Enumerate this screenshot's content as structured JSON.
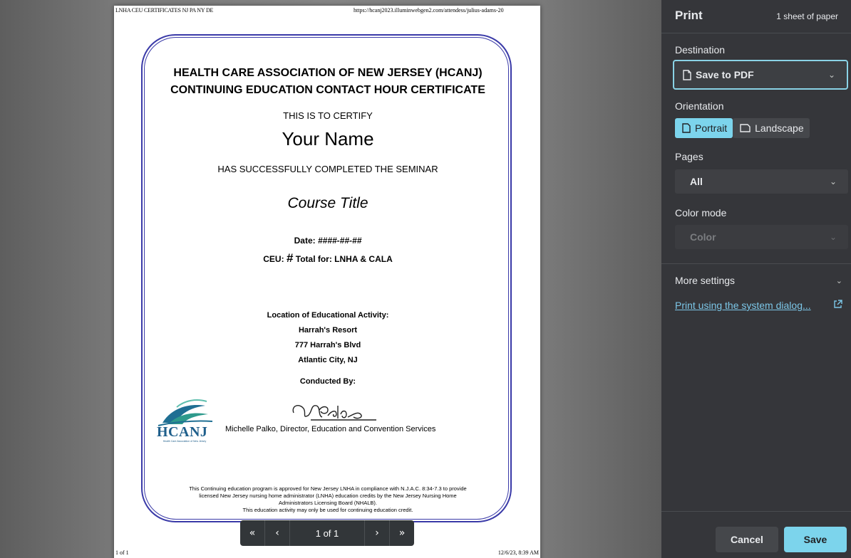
{
  "document": {
    "header_left": "LNHA CEU CERTIFICATES NJ PA NY DE",
    "header_right": "https://hcanj2023.illuminwebgen2.com/attendess/julius-adams-20",
    "footer_left": "1 of 1",
    "footer_right": "12/6/23, 8:39 AM",
    "title_line1": "HEALTH CARE ASSOCIATION OF NEW JERSEY (HCANJ)",
    "title_line2": "CONTINUING EDUCATION CONTACT HOUR CERTIFICATE",
    "certify": "THIS IS TO CERTIFY",
    "name": "Your Name",
    "completed": "HAS SUCCESSFULLY COMPLETED THE SEMINAR",
    "course": "Course Title",
    "date_label": "Date:",
    "date_value": "####-##-##",
    "ceu_label": "CEU:",
    "ceu_value": "#",
    "total_for": "Total for: LNHA & CALA",
    "location_label": "Location of Educational Activity:",
    "location_lines": [
      "Harrah's Resort",
      "777 Harrah's Blvd",
      "Atlantic City, NJ"
    ],
    "conducted_by": "Conducted By:",
    "signature_text": "Palko",
    "signer": "Michelle Palko, Director, Education and Convention Services",
    "logo_text": "HCANJ",
    "logo_subtext": "Health Care Association of New Jersey",
    "fine_print": [
      "This Continuing education program is approved for New Jersey LNHA in compliance with N.J.A.C. 8:34-7.3 to provide",
      "licensed New Jersey nursing home administrator (LNHA) education credits by the New Jersey Nursing Home",
      "Administrators Licensing Board (NHALB).",
      "This education activity may only be used for continuing education credit."
    ],
    "page_indicator": "1 of 1"
  },
  "print": {
    "title": "Print",
    "sheets": "1 sheet of paper",
    "destination_label": "Destination",
    "destination_value": "Save to PDF",
    "orientation_label": "Orientation",
    "orientation_portrait": "Portrait",
    "orientation_landscape": "Landscape",
    "pages_label": "Pages",
    "pages_value": "All",
    "color_mode_label": "Color mode",
    "color_mode_value": "Color",
    "more_settings": "More settings",
    "system_dialog": "Print using the system dialog...",
    "cancel": "Cancel",
    "save": "Save"
  },
  "icons": {
    "first_page": "«",
    "prev_page": "‹",
    "next_page": "›",
    "last_page": "»",
    "dropdown": "chevron-down-icon"
  },
  "colors": {
    "accent": "#7cd4ec",
    "panel": "#35363a",
    "frame": "#3a3aa8"
  }
}
